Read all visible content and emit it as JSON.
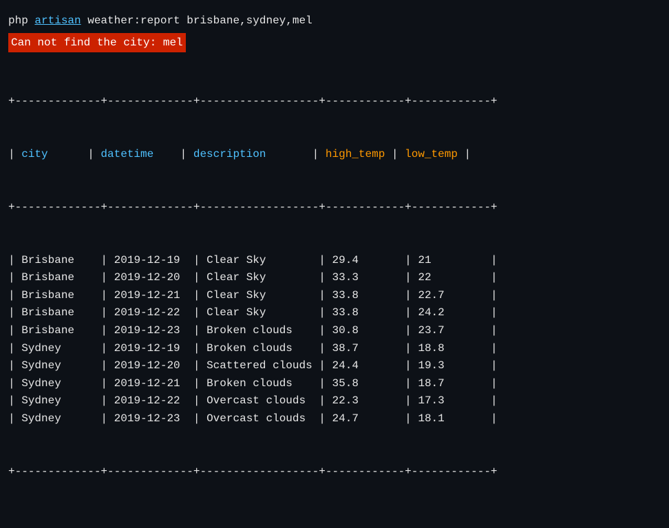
{
  "command": {
    "prefix": "php ",
    "artisan": "artisan",
    "suffix": " weather:report brisbane,sydney,mel"
  },
  "error": "Can not find the city: mel",
  "table": {
    "separator": "+-------------+-------------+------------------+------------+------------+",
    "header": {
      "city": "city",
      "datetime": "datetime",
      "description": "description",
      "high_temp": "high_temp",
      "low_temp": "low_temp"
    },
    "rows": [
      {
        "city": "Brisbane",
        "datetime": "2019-12-19",
        "description": "Clear Sky",
        "high_temp": "29.4",
        "low_temp": "21"
      },
      {
        "city": "Brisbane",
        "datetime": "2019-12-20",
        "description": "Clear Sky",
        "high_temp": "33.3",
        "low_temp": "22"
      },
      {
        "city": "Brisbane",
        "datetime": "2019-12-21",
        "description": "Clear Sky",
        "high_temp": "33.8",
        "low_temp": "22.7"
      },
      {
        "city": "Brisbane",
        "datetime": "2019-12-22",
        "description": "Clear Sky",
        "high_temp": "33.8",
        "low_temp": "24.2"
      },
      {
        "city": "Brisbane",
        "datetime": "2019-12-23",
        "description": "Broken clouds",
        "high_temp": "30.8",
        "low_temp": "23.7"
      },
      {
        "city": "Sydney",
        "datetime": "2019-12-19",
        "description": "Broken clouds",
        "high_temp": "38.7",
        "low_temp": "18.8"
      },
      {
        "city": "Sydney",
        "datetime": "2019-12-20",
        "description": "Scattered clouds",
        "high_temp": "24.4",
        "low_temp": "19.3"
      },
      {
        "city": "Sydney",
        "datetime": "2019-12-21",
        "description": "Broken clouds",
        "high_temp": "35.8",
        "low_temp": "18.7"
      },
      {
        "city": "Sydney",
        "datetime": "2019-12-22",
        "description": "Overcast clouds",
        "high_temp": "22.3",
        "low_temp": "17.3"
      },
      {
        "city": "Sydney",
        "datetime": "2019-12-23",
        "description": "Overcast clouds",
        "high_temp": "24.7",
        "low_temp": "18.1"
      }
    ]
  }
}
